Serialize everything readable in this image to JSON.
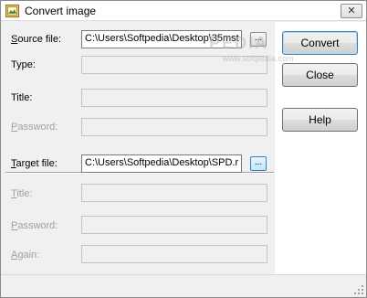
{
  "window": {
    "title": "Convert image"
  },
  "form": {
    "source": {
      "label_ul": "S",
      "label_rest": "ource file:",
      "value": "C:\\Users\\Softpedia\\Desktop\\35mst",
      "browse_label": "..."
    },
    "type": {
      "label": "Type:",
      "value": ""
    },
    "title": {
      "label": "Title:",
      "value": ""
    },
    "password": {
      "label_ul": "P",
      "label_rest": "assword:",
      "value": ""
    },
    "target": {
      "label_ul": "T",
      "label_rest": "arget file:",
      "value": "C:\\Users\\Softpedia\\Desktop\\SPD.r",
      "browse_label": "..."
    },
    "target_title": {
      "label_ul": "T",
      "label_rest": "itle:",
      "value": ""
    },
    "target_password": {
      "label_ul": "P",
      "label_rest": "assword:",
      "value": ""
    },
    "again": {
      "label_ul": "A",
      "label_rest": "gain:",
      "value": ""
    }
  },
  "buttons": {
    "convert": "Convert",
    "close": "Close",
    "help": "Help"
  },
  "watermark": {
    "main": "PEDIA",
    "sub": "www.softpedia.com"
  },
  "colors": {
    "disabled_text": "#a0a0a0",
    "focus_border": "#3c7fb1"
  }
}
